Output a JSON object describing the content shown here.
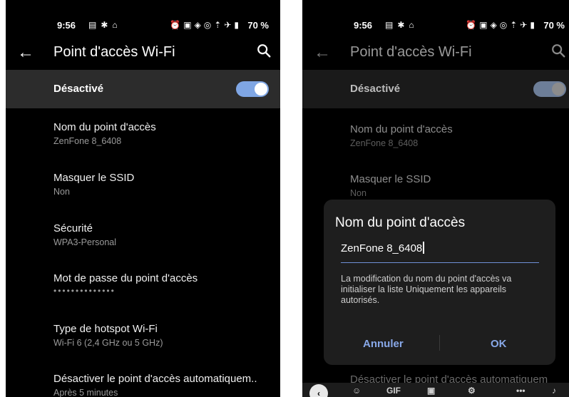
{
  "left": {
    "status": {
      "time": "9:56",
      "battery": "70 %"
    },
    "appbar": {
      "title": "Point d'accès Wi-Fi"
    },
    "master": {
      "label": "Désactivé",
      "toggle_on": true
    },
    "items": [
      {
        "title": "Nom du point d'accès",
        "subtitle": "ZenFone 8_6408"
      },
      {
        "title": "Masquer le SSID",
        "subtitle": "Non"
      },
      {
        "title": "Sécurité",
        "subtitle": "WPA3-Personal"
      },
      {
        "title": "Mot de passe du point d'accès",
        "subtitle": "••••••••••••••"
      },
      {
        "title": "Type de hotspot Wi-Fi",
        "subtitle": "Wi-Fi 6 (2,4 GHz ou 5 GHz)"
      },
      {
        "title": "Désactiver le point d'accès automatiquem..",
        "subtitle": "Après 5 minutes"
      }
    ]
  },
  "right": {
    "status": {
      "time": "9:56",
      "battery": "70 %"
    },
    "appbar": {
      "title": "Point d'accès Wi-Fi"
    },
    "master": {
      "label": "Désactivé"
    },
    "items": [
      {
        "title": "Nom du point d'accès",
        "subtitle": "ZenFone 8_6408"
      },
      {
        "title": "Masquer le SSID",
        "subtitle": "Non"
      },
      {
        "title": "Désactiver le point d'accès automatiquem"
      }
    ],
    "dialog": {
      "title": "Nom du point d'accès",
      "value": "ZenFone 8_6408",
      "message": "La modification du nom du point d'accès va initialiser la liste Uniquement les appareils autorisés.",
      "cancel": "Annuler",
      "ok": "OK"
    },
    "keyboard": {
      "gif": "GIF"
    }
  }
}
